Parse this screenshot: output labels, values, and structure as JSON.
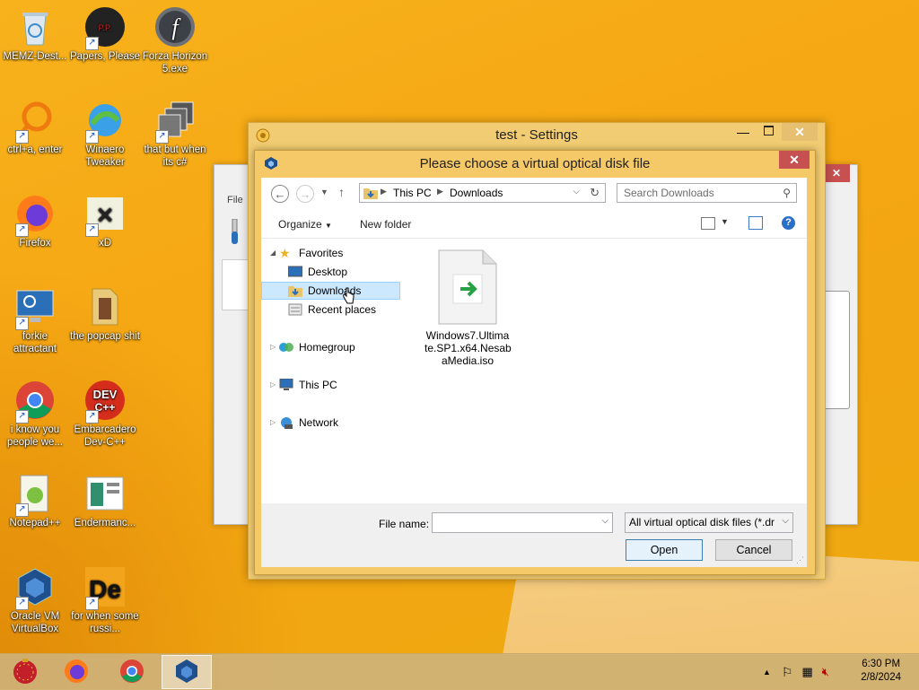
{
  "desktop": {
    "icons": [
      {
        "label": "MEMZ-Dest...",
        "icon": "recycle-bin-icon"
      },
      {
        "label": "Papers, Please",
        "icon": "papers-please-icon"
      },
      {
        "label": "Forza Horizon 5.exe",
        "icon": "flash-icon"
      },
      {
        "label": "ctrl+a, enter",
        "icon": "search-ring-icon"
      },
      {
        "label": "Winaero Tweaker",
        "icon": "winaero-icon"
      },
      {
        "label": "that but when its c#",
        "icon": "stacked-windows-icon"
      },
      {
        "label": "Firefox",
        "icon": "firefox-icon"
      },
      {
        "label": "xD",
        "icon": "xd-icon"
      },
      {
        "label": "forkie attractant",
        "icon": "monitor-gear-icon"
      },
      {
        "label": "the popcap shit",
        "icon": "folder-icon"
      },
      {
        "label": "i know you people we...",
        "icon": "chrome-icon"
      },
      {
        "label": "Embarcadero Dev-C++",
        "icon": "devcpp-icon"
      },
      {
        "label": "Notepad++",
        "icon": "notepadpp-icon"
      },
      {
        "label": "Endermanc...",
        "icon": "app-window-icon"
      },
      {
        "label": "Oracle VM VirtualBox",
        "icon": "virtualbox-icon"
      },
      {
        "label": "for when some russi...",
        "icon": "de-icon"
      }
    ]
  },
  "taskbar": {
    "apps": [
      "start-orb-icon",
      "firefox-icon",
      "chrome-icon",
      "virtualbox-icon"
    ],
    "time": "6:30 PM",
    "date": "2/8/2024"
  },
  "vbox_window": {
    "menu_file": "File"
  },
  "settings_window": {
    "title": "test - Settings"
  },
  "dialog": {
    "title": "Please choose a virtual optical disk file",
    "breadcrumb": [
      "This PC",
      "Downloads"
    ],
    "search_placeholder": "Search Downloads",
    "toolbar": {
      "organize": "Organize",
      "new_folder": "New folder"
    },
    "tree": {
      "favorites": "Favorites",
      "desktop": "Desktop",
      "downloads": "Downloads",
      "recent": "Recent places",
      "homegroup": "Homegroup",
      "thispc": "This PC",
      "network": "Network"
    },
    "file": {
      "name": "Windows7.Ultimate.SP1.x64.NesabaMedia.iso",
      "line1": "Windows7.Ultima",
      "line2": "te.SP1.x64.Nesab",
      "line3": "aMedia.iso"
    },
    "filename_label": "File name:",
    "filename_value": "",
    "filter": "All virtual optical disk files (*.dr",
    "open": "Open",
    "cancel": "Cancel"
  },
  "colors": {
    "accent": "#f5c868",
    "close": "#c75050",
    "selection": "#cce8ff"
  }
}
